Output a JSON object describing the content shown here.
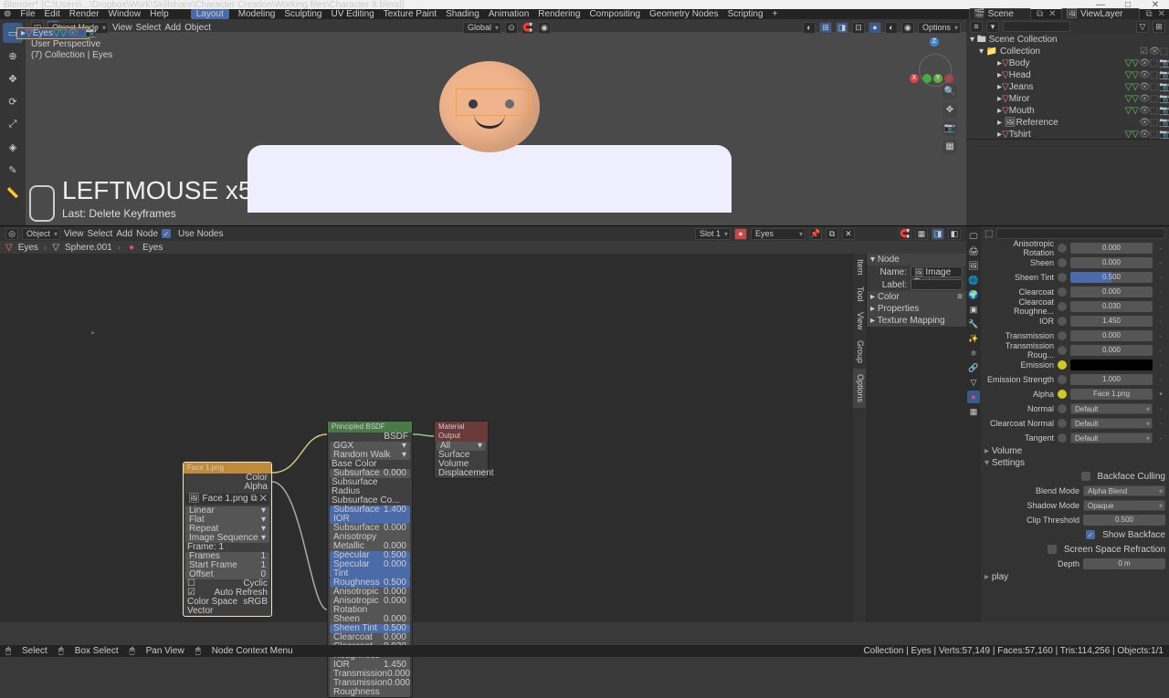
{
  "window": {
    "title": "Blender* [C:\\Users\\...\\Dropbox\\Work\\Skillshare\\Character Creation\\Working files\\Character 8.blend]"
  },
  "topmenu": [
    "File",
    "Edit",
    "Render",
    "Window",
    "Help"
  ],
  "workspaces": [
    "Layout",
    "Modeling",
    "Sculpting",
    "UV Editing",
    "Texture Paint",
    "Shading",
    "Animation",
    "Rendering",
    "Compositing",
    "Geometry Nodes",
    "Scripting",
    "+"
  ],
  "active_workspace": "Layout",
  "top_right": {
    "scene_label": "Scene",
    "layer_label": "ViewLayer"
  },
  "vp_header": {
    "mode": "Object Mode",
    "menus": [
      "View",
      "Select",
      "Add",
      "Object"
    ],
    "orientation": "Global",
    "options": "Options"
  },
  "vp_info": {
    "l1": "User Perspective",
    "l2": "(7) Collection | Eyes"
  },
  "overlay": {
    "big": "LEFTMOUSE x5",
    "small": "Last: Delete Keyframes"
  },
  "gizmo": {
    "x": "X",
    "y": "Y",
    "z": "Z"
  },
  "outliner": {
    "search_ph": "",
    "root": "Scene Collection",
    "coll": "Collection",
    "items": [
      {
        "name": "Body",
        "depth": 2
      },
      {
        "name": "Eyes",
        "depth": 2,
        "sel": true
      },
      {
        "name": "Head",
        "depth": 2
      },
      {
        "name": "Jeans",
        "depth": 2
      },
      {
        "name": "Miror",
        "depth": 2
      },
      {
        "name": "Mouth",
        "depth": 2
      },
      {
        "name": "Reference",
        "depth": 2,
        "img": true
      },
      {
        "name": "Tshirt",
        "depth": 2
      }
    ]
  },
  "node_hd": {
    "type": "Object",
    "menus": [
      "View",
      "Select",
      "Add",
      "Node"
    ],
    "use_nodes": "Use Nodes",
    "slot": "Slot 1",
    "mat": "Eyes"
  },
  "breadcrumb": [
    "Eyes",
    "Sphere.001",
    "Eyes"
  ],
  "n_panel": {
    "node_section": "Node",
    "name_label": "Name:",
    "name_val": "Image Texture",
    "label_label": "Label:",
    "color": "Color",
    "props": "Properties",
    "texmap": "Texture Mapping",
    "tabs": [
      "Item",
      "Tool",
      "View",
      "Group",
      "Options"
    ]
  },
  "nodes": {
    "img": {
      "title": "Face 1.png",
      "out_color": "Color",
      "out_alpha": "Alpha",
      "file": "Face 1.png",
      "interp": "Linear",
      "proj": "Flat",
      "ext": "Repeat",
      "src": "Image Sequence",
      "frame_l": "Frame: 1",
      "frames": "Frames",
      "start": "Start Frame",
      "offset": "Offset",
      "cyclic": "Cyclic",
      "auto": "Auto Refresh",
      "cspace": "Color Space",
      "cspace_v": "sRGB",
      "vector": "Vector"
    },
    "bsdf": {
      "title": "Principled BSDF",
      "out": "BSDF",
      "dist": "GGX",
      "sss": "Random Walk",
      "rows": [
        {
          "l": "Base Color",
          "blue": false
        },
        {
          "l": "Subsurface",
          "v": "0.000"
        },
        {
          "l": "Subsurface Radius"
        },
        {
          "l": "Subsurface Co..."
        },
        {
          "l": "Subsurface IOR",
          "v": "1.400",
          "blue": true
        },
        {
          "l": "Subsurface Anisotropy",
          "v": "0.000"
        },
        {
          "l": "Metallic",
          "v": "0.000"
        },
        {
          "l": "Specular",
          "v": "0.500",
          "blue": true
        },
        {
          "l": "Specular Tint",
          "v": "0.000",
          "blue": true
        },
        {
          "l": "Roughness",
          "v": "0.500",
          "blue": true
        },
        {
          "l": "Anisotropic",
          "v": "0.000"
        },
        {
          "l": "Anisotropic Rotation",
          "v": "0.000"
        },
        {
          "l": "Sheen",
          "v": "0.000"
        },
        {
          "l": "Sheen Tint",
          "v": "0.500",
          "blue": true
        },
        {
          "l": "Clearcoat",
          "v": "0.000"
        },
        {
          "l": "Clearcoat Roughness",
          "v": "0.030"
        },
        {
          "l": "IOR",
          "v": "1.450"
        },
        {
          "l": "Transmission",
          "v": "0.000"
        },
        {
          "l": "Transmission Roughness",
          "v": "0.000"
        }
      ]
    },
    "out": {
      "title": "Material Output",
      "all": "All",
      "surf": "Surface",
      "vol": "Volume",
      "disp": "Displacement"
    }
  },
  "props": {
    "rows": [
      {
        "l": "Anisotropic Rotation",
        "v": "0.000"
      },
      {
        "l": "Sheen",
        "v": "0.000"
      },
      {
        "l": "Sheen Tint",
        "v": "0.500",
        "half": true
      },
      {
        "l": "Clearcoat",
        "v": "0.000"
      },
      {
        "l": "Clearcoat Roughne...",
        "v": "0.030"
      },
      {
        "l": "IOR",
        "v": "1.450"
      },
      {
        "l": "Transmission",
        "v": "0.000"
      },
      {
        "l": "Transmission Roug...",
        "v": "0.000"
      },
      {
        "l": "Emission",
        "black": true,
        "ylw": true
      },
      {
        "l": "Emission Strength",
        "v": "1.000"
      },
      {
        "l": "Alpha",
        "v": "Face 1.png",
        "link": true,
        "ylw": true
      },
      {
        "l": "Normal",
        "v": "Default",
        "drop": true
      },
      {
        "l": "Clearcoat Normal",
        "v": "Default",
        "drop": true
      },
      {
        "l": "Tangent",
        "v": "Default",
        "drop": true
      }
    ],
    "volume": "Volume",
    "settings": "Settings",
    "backface": "Backface Culling",
    "blend_l": "Blend Mode",
    "blend_v": "Alpha Blend",
    "shadow_l": "Shadow Mode",
    "shadow_v": "Opaque",
    "clip_l": "Clip Threshold",
    "clip_v": "0.500",
    "showback": "Show Backface",
    "ssr": "Screen Space Refraction",
    "depth_l": "Depth",
    "depth_v": "0 m",
    "display": "play"
  },
  "status": {
    "select": "Select",
    "box": "Box Select",
    "pan": "Pan View",
    "ctx": "Node Context Menu",
    "right": "Collection | Eyes | Verts:57,149 | Faces:57,160 | Tris:114,256 | Objects:1/1"
  }
}
